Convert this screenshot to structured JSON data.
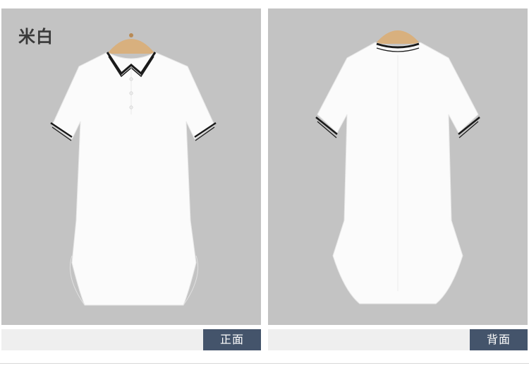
{
  "color_name": "米白",
  "views": [
    {
      "label": "正面"
    },
    {
      "label": "背面"
    }
  ],
  "colors": {
    "panel_bg": "#c3c3c3",
    "tag_bg": "#44546b",
    "garment": "#fbfbfb",
    "trim": "#1a1a1a",
    "hanger": "#d8b07e"
  }
}
